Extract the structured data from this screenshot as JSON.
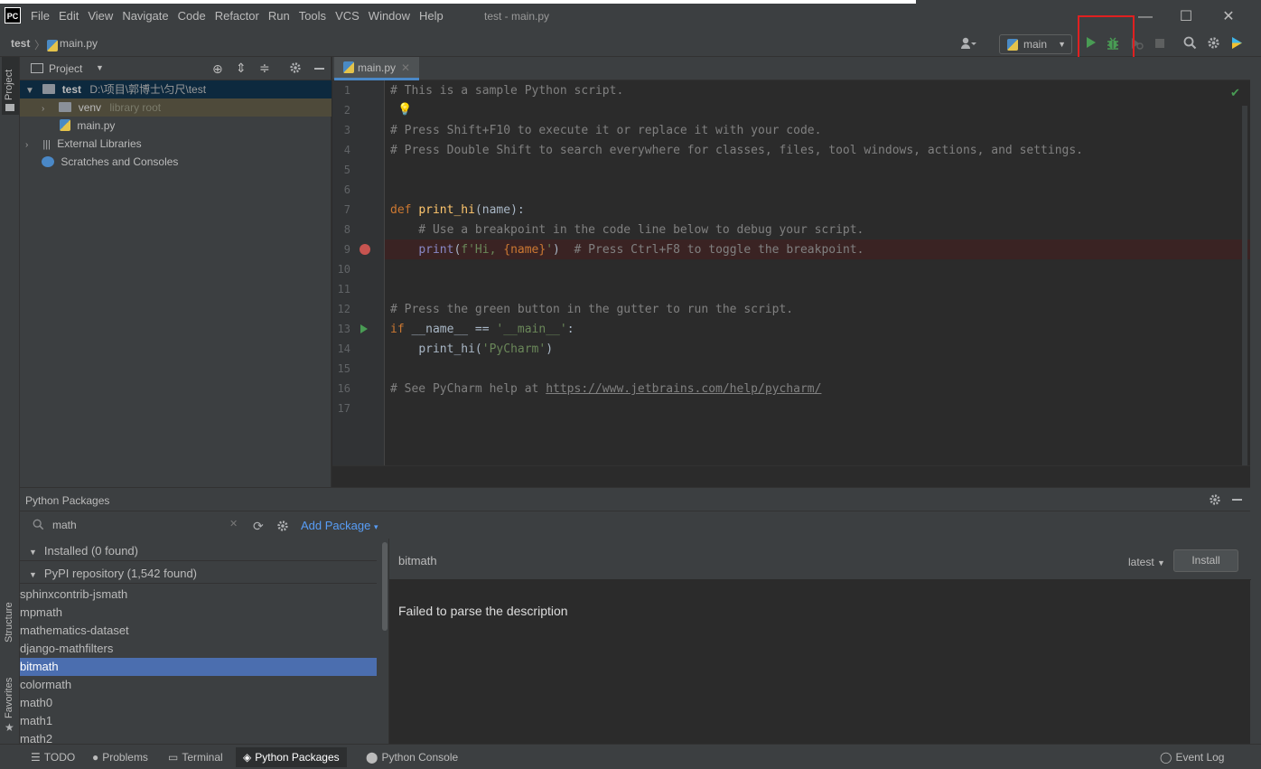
{
  "window": {
    "logo": "PC",
    "title": "test - main.py",
    "menu": [
      "File",
      "Edit",
      "View",
      "Navigate",
      "Code",
      "Refactor",
      "Run",
      "Tools",
      "VCS",
      "Window",
      "Help"
    ],
    "controls": {
      "minimize": "—",
      "maximize": "☐",
      "close": "✕"
    }
  },
  "navbar": {
    "project": "test",
    "separator": "〉",
    "file": "main.py",
    "run_config": "main",
    "caret": "▼"
  },
  "left_tabs": {
    "project": "Project",
    "structure": "Structure",
    "favorites": "Favorites"
  },
  "project_panel": {
    "title": "Project",
    "caret": "▼",
    "tree": [
      {
        "arrow": "▼",
        "label": "test",
        "path": "D:\\项目\\郭博士\\匀尺\\test"
      },
      {
        "arrow": "›",
        "label": "venv",
        "hint": "library root"
      },
      {
        "arrow": "",
        "label": "main.py"
      },
      {
        "arrow": "›",
        "label": "External Libraries"
      },
      {
        "arrow": "",
        "label": "Scratches and Consoles"
      }
    ]
  },
  "editor": {
    "tab": "main.py",
    "tab_close": "✕",
    "line_numbers": [
      "1",
      "2",
      "3",
      "4",
      "5",
      "6",
      "7",
      "8",
      "9",
      "10",
      "11",
      "12",
      "13",
      "14",
      "15",
      "16",
      "17"
    ],
    "lines": {
      "l1": "# This is a sample Python script.",
      "l3": "# Press Shift+F10 to execute it or replace it with your code.",
      "l4": "# Press Double Shift to search everywhere for classes, files, tool windows, actions, and settings.",
      "l7_kw": "def",
      "l7_fn": "print_hi",
      "l7_rest": "(name):",
      "l8": "    # Use a breakpoint in the code line below to debug your script.",
      "l9_indent": "    ",
      "l9_print": "print",
      "l9_open": "(",
      "l9_str1": "f'Hi, ",
      "l9_var": "{name}",
      "l9_str2": "'",
      "l9_close": ")  ",
      "l9_cmt": "# Press Ctrl+F8 to toggle the breakpoint.",
      "l12": "# Press the green button in the gutter to run the script.",
      "l13_kw": "if",
      "l13_mid": " __name__ == ",
      "l13_str": "'__main__'",
      "l13_end": ":",
      "l14_indent": "    ",
      "l14_fn": "print_hi(",
      "l14_str": "'PyCharm'",
      "l14_end": ")",
      "l16_pre": "# See PyCharm help at ",
      "l16_link": "https://www.jetbrains.com/help/pycharm/"
    }
  },
  "packages": {
    "title": "Python Packages",
    "search_value": "math",
    "add_package": "Add Package",
    "installed": "Installed (0 found)",
    "pypi": "PyPI repository (1,542 found)",
    "list": [
      "sphinxcontrib-jsmath",
      "mpmath",
      "mathematics-dataset",
      "django-mathfilters",
      "bitmath",
      "colormath",
      "math0",
      "math1",
      "math2"
    ],
    "selected": "bitmath",
    "detail": {
      "name": "bitmath",
      "version": "latest",
      "install": "Install",
      "description": "Failed to parse the description"
    }
  },
  "bottom_tabs": [
    "TODO",
    "Problems",
    "Terminal",
    "Python Packages",
    "Python Console"
  ],
  "event_log": "Event Log",
  "colors": {
    "accent": "#4a88c7",
    "selection": "#4b6eaf",
    "run_green": "#499c54",
    "breakpoint": "#c75450",
    "highlight": "#e02020"
  }
}
